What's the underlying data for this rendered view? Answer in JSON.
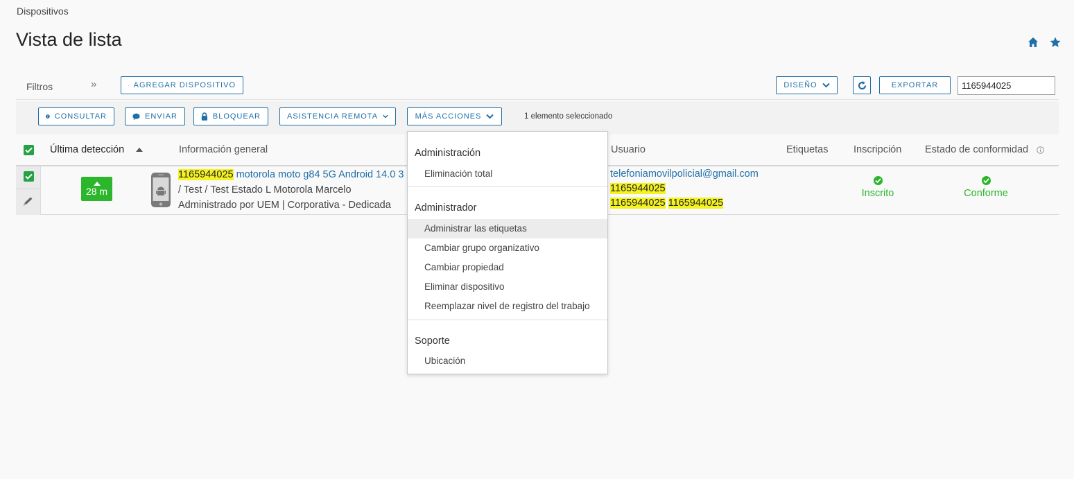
{
  "breadcrumb": "Dispositivos",
  "page_title": "Vista de lista",
  "toolbar": {
    "filters_label": "Filtros",
    "filters_expand": "»",
    "add_device": "AGREGAR DISPOSITIVO",
    "layout": "DISEÑO",
    "export": "EXPORTAR",
    "search_value": "1165944025"
  },
  "actions": {
    "consult": "CONSULTAR",
    "send": "ENVIAR",
    "lock": "BLOQUEAR",
    "remote_assist": "ASISTENCIA REMOTA",
    "more_actions": "MÁS ACCIONES",
    "selected_count": "1 elemento seleccionado"
  },
  "columns": {
    "last_seen": "Última detección",
    "general_info": "Información general",
    "user": "Usuario",
    "tags": "Etiquetas",
    "enrollment": "Inscripción",
    "compliance": "Estado de conformidad"
  },
  "row": {
    "last_seen": "28 m",
    "device_id": "1165944025",
    "device_name": " motorola moto g84 5G Android 14.0 3",
    "line2": "/ Test / Test Estado L Motorola Marcelo",
    "line3": "Administrado por UEM | Corporativa - Dedicada",
    "user_email": "telefoniamovilpolicial@gmail.com",
    "user_line2": "1165944025",
    "user_line3a": "1165944025",
    "user_line3b": "1165944025",
    "enrollment": "Inscrito",
    "compliance": "Conforme"
  },
  "menu": {
    "sections": [
      {
        "header": "Administración",
        "items": [
          "Eliminación total"
        ]
      },
      {
        "header": "Administrador",
        "items": [
          "Administrar las etiquetas",
          "Cambiar grupo organizativo",
          "Cambiar propiedad",
          "Eliminar dispositivo",
          "Reemplazar nivel de registro del trabajo"
        ]
      },
      {
        "header": "Soporte",
        "items": [
          "Ubicación"
        ]
      }
    ]
  },
  "colors": {
    "accent": "#1f6fa8",
    "success": "#2bb62b",
    "highlight": "#f4f221"
  }
}
